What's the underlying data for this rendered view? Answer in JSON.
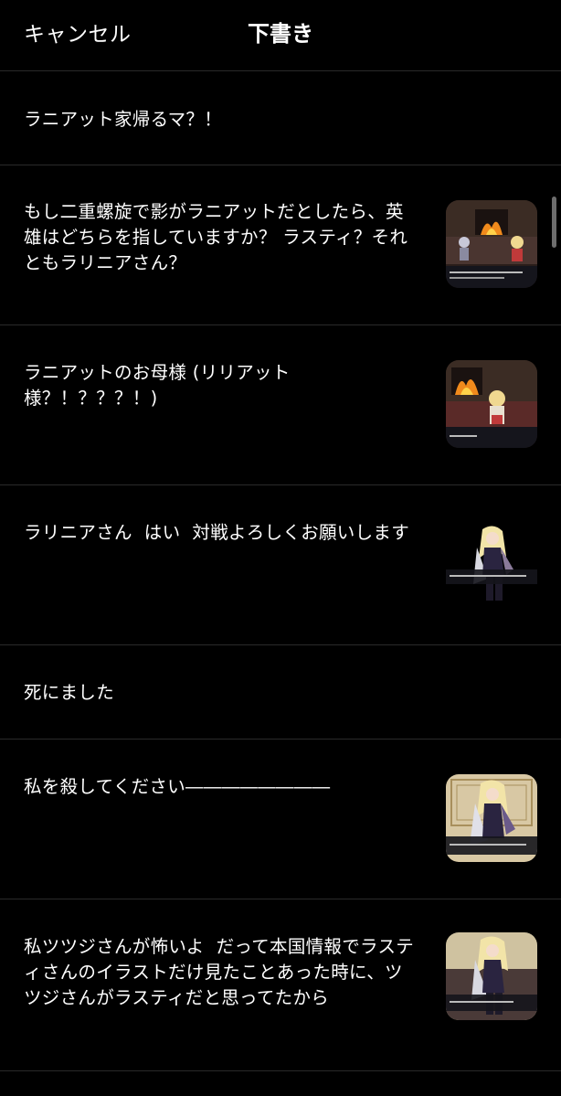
{
  "header": {
    "cancel_label": "キャンセル",
    "title": "下書き"
  },
  "drafts": [
    {
      "text": "ラニアット家帰るマ？！",
      "thumbnail": "none"
    },
    {
      "text": "もし二重螺旋で影がラニアットだとしたら、英雄はどちらを指していますか？ ラスティ？それともラリニアさん？",
      "thumbnail": "fireplace-scene-with-two-characters"
    },
    {
      "text": "ラニアットのお母様 (リリアット様？！？？？！)",
      "thumbnail": "fireplace-scene-with-blonde-character"
    },
    {
      "text": "ラリニアさん  はい  対戦よろしくお願いします",
      "thumbnail": "armored-woman-character"
    },
    {
      "text": "死にました",
      "thumbnail": "none"
    },
    {
      "text": "私を殺してください――――――――",
      "thumbnail": "armored-woman-character-ornate-background"
    },
    {
      "text": "私ツツジさんが怖いよ  だって本国情報でラスティさんのイラストだけ見たことあった時に、ツツジさんがラスティだと思ってたから",
      "thumbnail": "armored-woman-character-dark-background"
    }
  ],
  "colors": {
    "background": "#000000",
    "text": "#ffffff",
    "divider": "#2a2a2a",
    "scrollbar": "#6d6d6d"
  }
}
